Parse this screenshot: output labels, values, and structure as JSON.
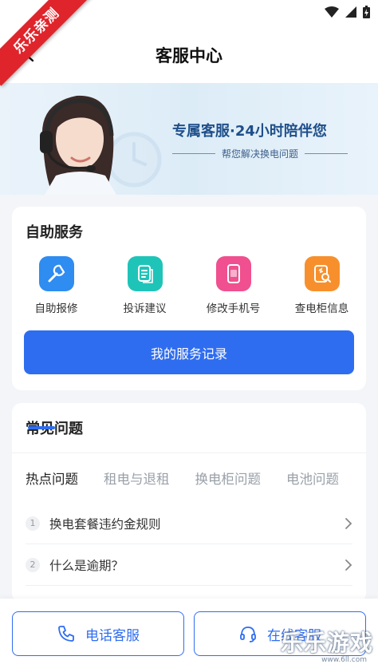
{
  "ribbon": "乐乐亲测",
  "header": {
    "title": "客服中心"
  },
  "banner": {
    "title": "专属客服·24小时陪伴您",
    "subtitle": "帮您解决换电问题"
  },
  "self_service": {
    "title": "自助服务",
    "items": [
      {
        "label": "自助报修",
        "icon": "wrench-icon",
        "color": "#2f8cf0"
      },
      {
        "label": "投诉建议",
        "icon": "document-icon",
        "color": "#1fc4b8"
      },
      {
        "label": "修改手机号",
        "icon": "phone-screen-icon",
        "color": "#f0508f"
      },
      {
        "label": "查电柜信息",
        "icon": "cabinet-search-icon",
        "color": "#f7902c"
      }
    ],
    "records_button": "我的服务记录"
  },
  "faq": {
    "title": "常见问题",
    "tabs": [
      "热点问题",
      "租电与退租",
      "换电柜问题",
      "电池问题"
    ],
    "active_tab": 0,
    "items": [
      {
        "num": "1",
        "text": "换电套餐违约金规则"
      },
      {
        "num": "2",
        "text": "什么是逾期？"
      }
    ]
  },
  "bottom": {
    "phone_label": "电话客服",
    "online_label": "在线客服"
  },
  "watermark": {
    "text": "乐乐游戏",
    "url": "www.6ll.com"
  },
  "colors": {
    "primary": "#2f6df0",
    "ribbon": "#e0242b"
  }
}
